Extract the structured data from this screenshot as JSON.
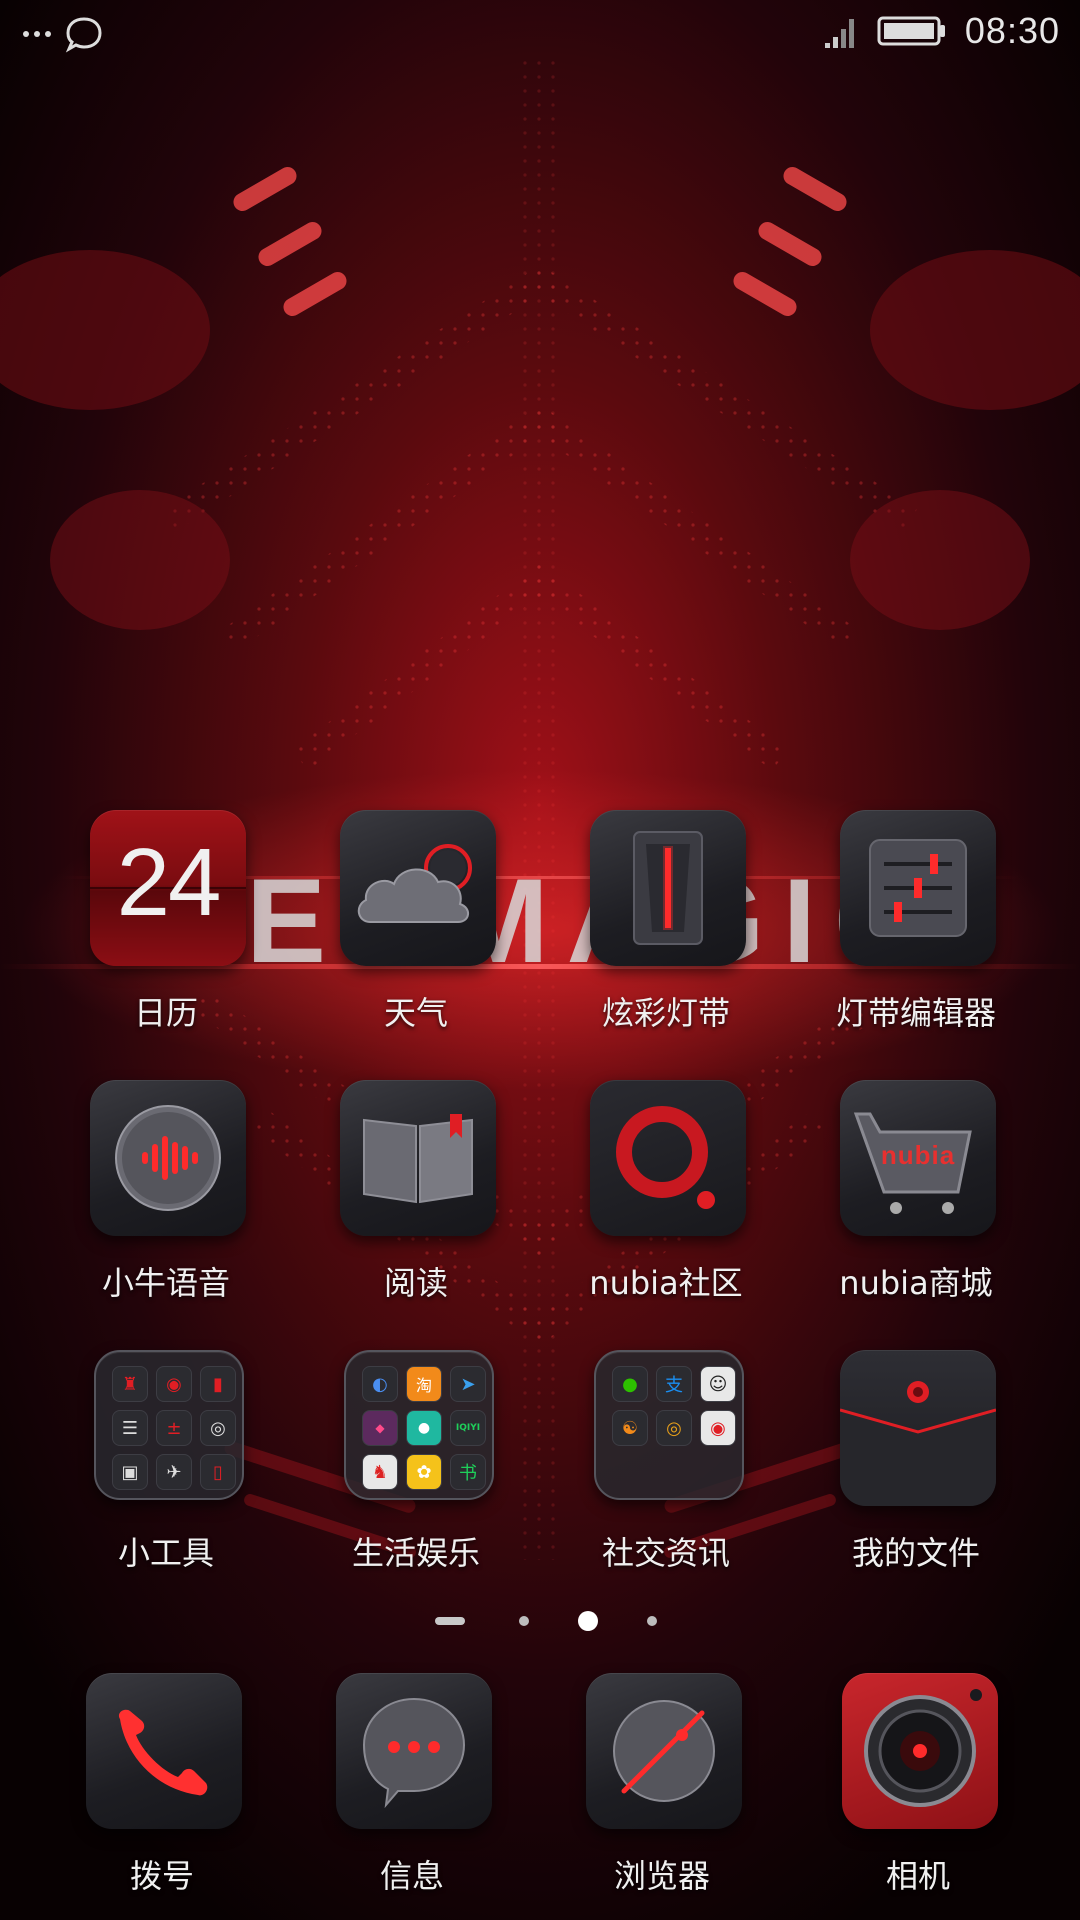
{
  "status_bar": {
    "time": "08:30",
    "left_icons": [
      "more-dots-icon",
      "chat-bubble-icon"
    ],
    "right_icons": [
      "signal-icon",
      "battery-icon"
    ]
  },
  "wallpaper": {
    "brand_text": "REDMAGIC",
    "accent": "#e01e24"
  },
  "home": {
    "apps": [
      {
        "label": "日历",
        "icon": "calendar-icon",
        "badge_text": "24"
      },
      {
        "label": "天气",
        "icon": "weather-icon"
      },
      {
        "label": "炫彩灯带",
        "icon": "led-strip-icon"
      },
      {
        "label": "灯带编辑器",
        "icon": "led-editor-icon"
      },
      {
        "label": "小牛语音",
        "icon": "voice-assistant-icon"
      },
      {
        "label": "阅读",
        "icon": "book-icon"
      },
      {
        "label": "nubia社区",
        "icon": "nubia-community-icon"
      },
      {
        "label": "nubia商城",
        "icon": "nubia-store-icon",
        "badge_text": "nubia"
      },
      {
        "label": "小工具",
        "icon": "tools-folder-icon"
      },
      {
        "label": "生活娱乐",
        "icon": "entertainment-folder-icon",
        "folder_text": [
          "淘",
          "IQIYI"
        ]
      },
      {
        "label": "社交资讯",
        "icon": "social-folder-icon",
        "folder_text": [
          "支"
        ]
      },
      {
        "label": "我的文件",
        "icon": "file-manager-icon"
      }
    ]
  },
  "page_indicator": {
    "pages": 4,
    "active_page": 3
  },
  "dock": {
    "apps": [
      {
        "label": "拨号",
        "icon": "phone-icon"
      },
      {
        "label": "信息",
        "icon": "message-icon"
      },
      {
        "label": "浏览器",
        "icon": "browser-compass-icon"
      },
      {
        "label": "相机",
        "icon": "camera-icon"
      }
    ]
  },
  "colors": {
    "accent_red": "#e01e24",
    "icon_dark": "#1d1d22",
    "label": "#f0f0f0"
  }
}
